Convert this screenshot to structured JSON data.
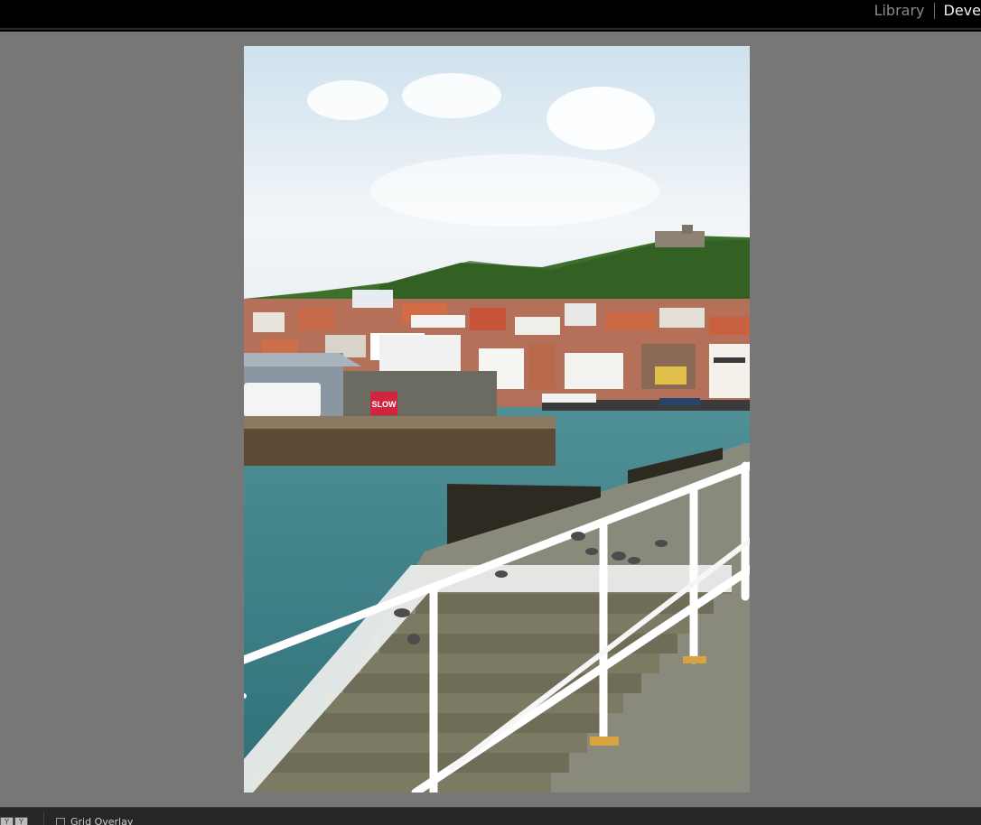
{
  "window": {
    "modules": [
      {
        "label": "Library",
        "active": false
      },
      {
        "label": "Deve",
        "active": true
      }
    ]
  },
  "photo": {
    "sign_text": "SLOW"
  },
  "toolbar": {
    "view_toggle_icon": "yy-icon",
    "view_toggle_glyph": "Y",
    "checkbox_label": "Grid Overlay"
  },
  "colors": {
    "background": "#777777",
    "topbar": "#000000",
    "toolbar": "#262626"
  }
}
